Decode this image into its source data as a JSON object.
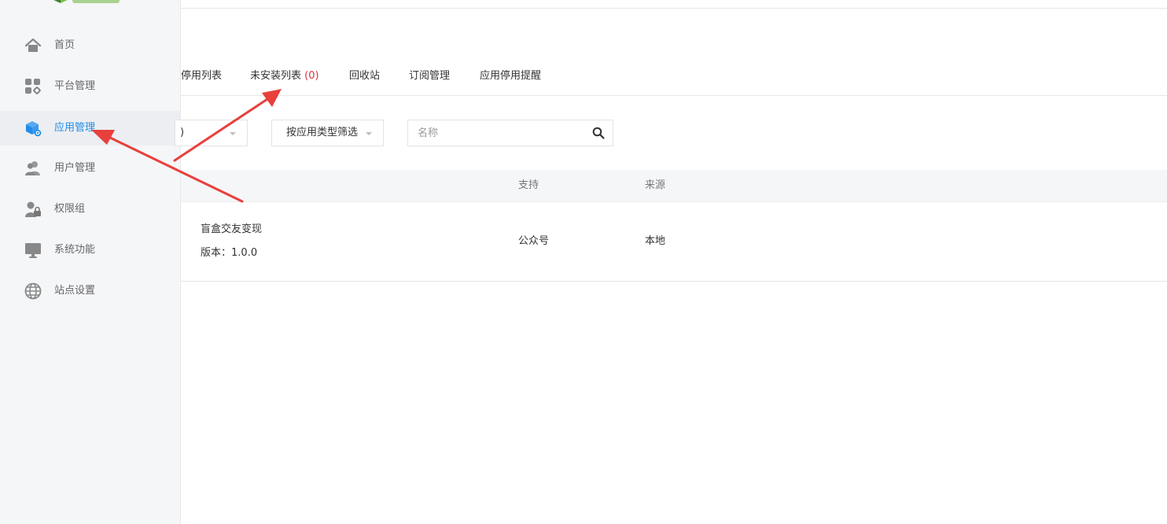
{
  "sidebar": {
    "items": [
      {
        "label": "首页",
        "icon": "home-icon",
        "active": false
      },
      {
        "label": "平台管理",
        "icon": "platform-grid-icon",
        "active": false
      },
      {
        "label": "应用管理",
        "icon": "app-cube-icon",
        "active": true
      },
      {
        "label": "用户管理",
        "icon": "users-icon",
        "active": false
      },
      {
        "label": "权限组",
        "icon": "user-lock-icon",
        "active": false
      },
      {
        "label": "系统功能",
        "icon": "monitor-icon",
        "active": false
      },
      {
        "label": "站点设置",
        "icon": "globe-icon",
        "active": false
      }
    ]
  },
  "tabs": [
    {
      "label": "停用列表"
    },
    {
      "label": "未安装列表",
      "count": "(0)"
    },
    {
      "label": "回收站"
    },
    {
      "label": "订阅管理"
    },
    {
      "label": "应用停用提醒"
    }
  ],
  "filters": {
    "first_select_partial": ")",
    "type_filter": "按应用类型筛选",
    "search_placeholder": "名称"
  },
  "table": {
    "headers": {
      "support": "支持",
      "source": "来源"
    },
    "rows": [
      {
        "name": "盲盒交友变现",
        "version_label": "版本：",
        "version": "1.0.0",
        "support": "公众号",
        "source": "本地"
      }
    ]
  },
  "colors": {
    "active": "#1f8ce8",
    "count": "#d9363e",
    "annotation_arrow": "#e8403c",
    "sidebar_bg": "#f5f6f8"
  }
}
